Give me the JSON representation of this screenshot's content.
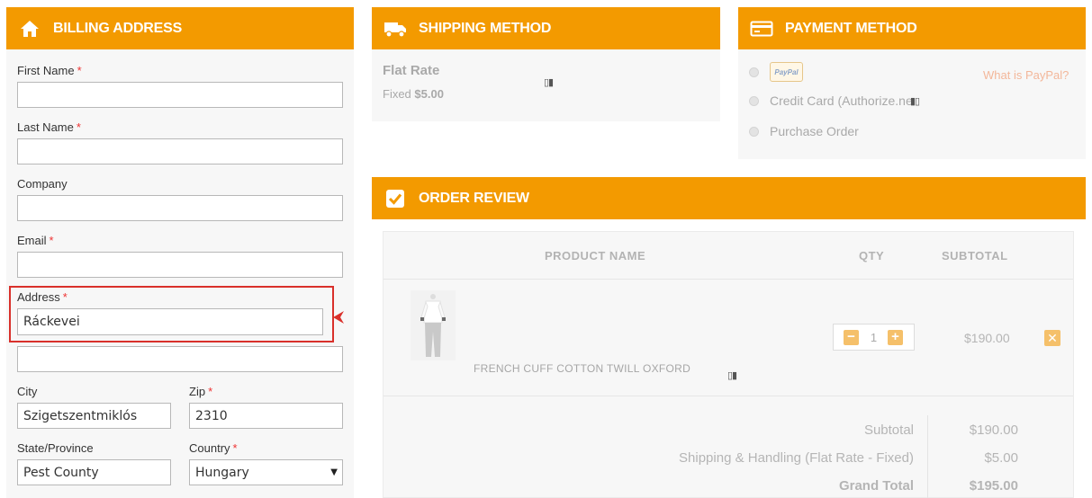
{
  "billing": {
    "title": "BILLING ADDRESS",
    "icon": "home-icon",
    "required_mark": "*",
    "first_name": {
      "label": "First Name",
      "value": ""
    },
    "last_name": {
      "label": "Last Name",
      "value": ""
    },
    "company": {
      "label": "Company",
      "value": ""
    },
    "email": {
      "label": "Email",
      "value": ""
    },
    "address": {
      "label": "Address",
      "value": "Ráckevei",
      "value2": ""
    },
    "city": {
      "label": "City",
      "value": "Szigetszentmiklós"
    },
    "zip": {
      "label": "Zip",
      "value": "2310"
    },
    "state": {
      "label": "State/Province",
      "value": "Pest County"
    },
    "country": {
      "label": "Country",
      "value": "Hungary"
    }
  },
  "shipping": {
    "title": "SHIPPING METHOD",
    "icon": "truck-icon",
    "method_name": "Flat Rate",
    "fixed_label": "Fixed",
    "price": "$5.00",
    "glyph": "▯▮"
  },
  "payment": {
    "title": "PAYMENT METHOD",
    "icon": "credit-card-icon",
    "paypal_badge": "PayPal",
    "what_is_paypal": "What is PayPal?",
    "credit_card_label": "Credit Card (Authorize.ne",
    "glyph": "▮▯",
    "purchase_order_label": "Purchase Order"
  },
  "review": {
    "title": "ORDER REVIEW",
    "icon": "checkbox-icon",
    "columns": {
      "product": "PRODUCT NAME",
      "qty": "QTY",
      "subtotal": "SUBTOTAL"
    },
    "item": {
      "name": "FRENCH CUFF COTTON TWILL OXFORD",
      "qty": "1",
      "subtotal": "$190.00",
      "glyph": "▯▮"
    },
    "totals": {
      "subtotal_label": "Subtotal",
      "subtotal_value": "$190.00",
      "shipping_label": "Shipping & Handling (Flat Rate - Fixed)",
      "shipping_value": "$5.00",
      "grand_label": "Grand Total",
      "grand_value": "$195.00"
    }
  },
  "colors": {
    "accent": "#f39a00",
    "panel_bg": "#f7f7f7",
    "highlight": "#d9302b"
  }
}
